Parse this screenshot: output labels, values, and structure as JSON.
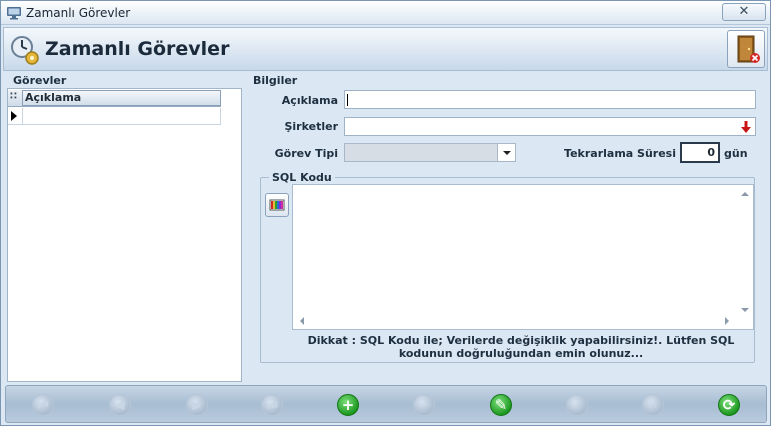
{
  "window": {
    "title": "Zamanlı Görevler",
    "close_glyph": "✕"
  },
  "header": {
    "title": "Zamanlı Görevler"
  },
  "left": {
    "section_label": "Görevler",
    "grid": {
      "columns": [
        "Açıklama"
      ],
      "rows": [
        ""
      ]
    }
  },
  "right": {
    "section_label": "Bilgiler",
    "fields": {
      "aciklama": {
        "label": "Açıklama",
        "value": ""
      },
      "sirketler": {
        "label": "Şirketler",
        "value": ""
      },
      "gorev_tipi": {
        "label": "Görev Tipi",
        "value": ""
      },
      "tekrarlama": {
        "label": "Tekrarlama Süresi",
        "value": "0",
        "unit": "gün"
      }
    },
    "sql": {
      "legend": "SQL Kodu",
      "value": "",
      "warning": "Dikkat : SQL Kodu ile; Verilerde değişiklik yapabilirsiniz!. Lütfen SQL kodunun doğruluğundan emin olunuz..."
    }
  },
  "toolbar": {
    "buttons": [
      {
        "name": "first-record",
        "icon": "first-icon",
        "glyph": "⏮",
        "enabled": false
      },
      {
        "name": "prev-record",
        "icon": "prev-icon",
        "glyph": "◀",
        "enabled": false
      },
      {
        "name": "next-record",
        "icon": "next-icon",
        "glyph": "▶",
        "enabled": false
      },
      {
        "name": "last-record",
        "icon": "last-icon",
        "glyph": "⏭",
        "enabled": false
      },
      {
        "name": "add",
        "icon": "plus-icon",
        "glyph": "+",
        "enabled": true
      },
      {
        "name": "delete",
        "icon": "minus-icon",
        "glyph": "−",
        "enabled": false
      },
      {
        "name": "edit",
        "icon": "edit-icon",
        "glyph": "✎",
        "enabled": true
      },
      {
        "name": "save",
        "icon": "check-icon",
        "glyph": "✓",
        "enabled": false
      },
      {
        "name": "cancel",
        "icon": "cancel-icon",
        "glyph": "✕",
        "enabled": false
      },
      {
        "name": "refresh",
        "icon": "refresh-icon",
        "glyph": "⟳",
        "enabled": true
      }
    ]
  }
}
